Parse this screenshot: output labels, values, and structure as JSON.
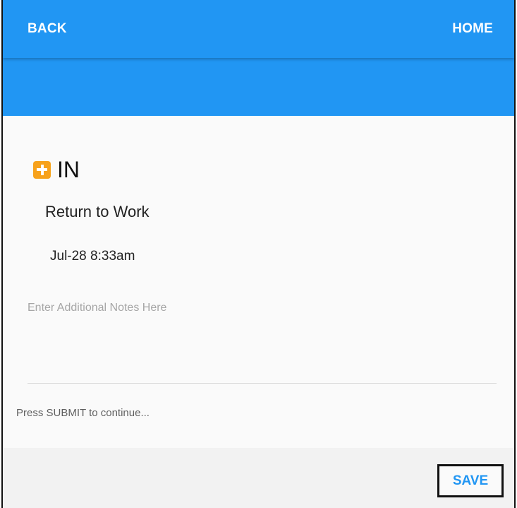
{
  "header": {
    "back_label": "BACK",
    "home_label": "HOME",
    "bar_color": "#2196f3"
  },
  "entry": {
    "status_icon": "plus-square-icon",
    "status_icon_color": "#f7a21b",
    "status": "IN",
    "reason": "Return to Work",
    "timestamp": "Jul-28 8:33am"
  },
  "notes": {
    "placeholder": "Enter Additional Notes Here",
    "value": ""
  },
  "hint": "Press SUBMIT to continue...",
  "footer": {
    "save_label": "SAVE"
  }
}
